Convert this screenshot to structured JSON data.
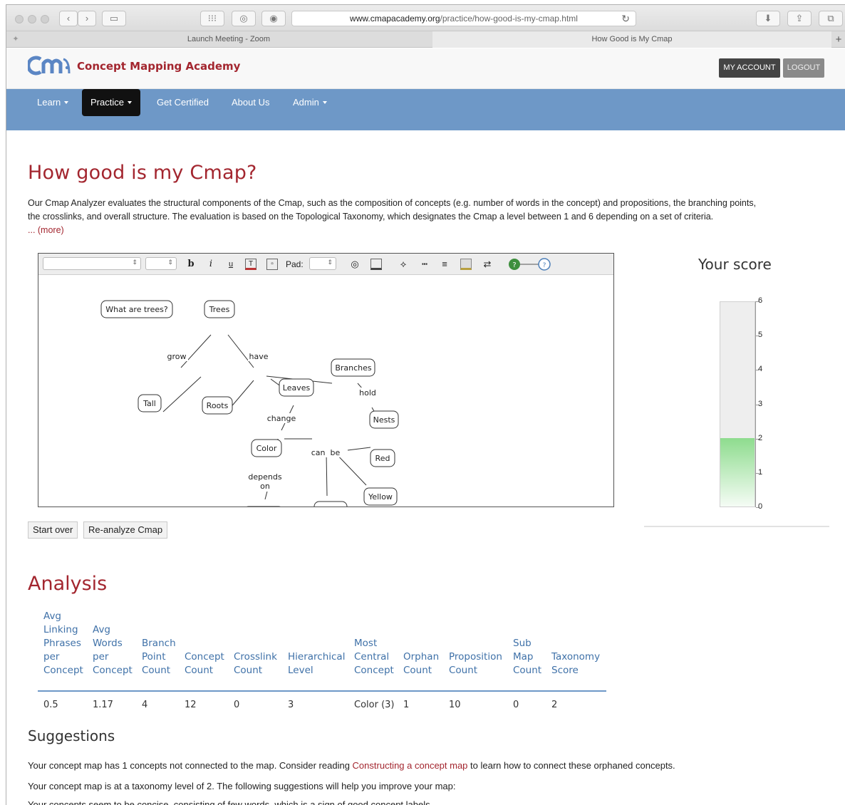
{
  "browser": {
    "url_host": "www.cmapacademy.org",
    "url_path": "/practice/how-good-is-my-cmap.html",
    "tabs": [
      "Launch Meeting - Zoom",
      "How Good is My Cmap"
    ]
  },
  "site": {
    "brand": "Concept Mapping Academy",
    "my_account": "MY ACCOUNT",
    "logout": "LOGOUT",
    "nav": [
      "Learn",
      "Practice",
      "Get Certified",
      "About Us",
      "Admin"
    ]
  },
  "page": {
    "title": "How good is my Cmap?",
    "intro_1": "Our Cmap Analyzer evaluates the structural components of the Cmap, such as the composition of concepts (e.g. number of words in the concept) and propositions, the branching points,",
    "intro_2": "the crosslinks, and overall structure. The evaluation is based on the Topological Taxonomy, which designates the Cmap a level between 1 and 6 depending on a set of criteria.",
    "more": "... (more)"
  },
  "toolbar": {
    "pad_label": "Pad:"
  },
  "cmap": {
    "concepts": [
      "What are trees?",
      "Trees",
      "Branches",
      "Leaves",
      "Tall",
      "Roots",
      "Nests",
      "Color",
      "Red",
      "Yellow"
    ],
    "links": [
      "grow",
      "have",
      "hold",
      "change",
      "can  be",
      "depends",
      "on"
    ]
  },
  "buttons": {
    "start_over": "Start over",
    "reanalyze": "Re-analyze Cmap"
  },
  "score": {
    "title": "Your score",
    "value": 2,
    "max": 6,
    "ticks": [
      "6",
      "5",
      "4",
      "3",
      "2",
      "1",
      "0"
    ]
  },
  "analysis": {
    "title": "Analysis",
    "headers": [
      [
        "Avg",
        "Linking",
        "Phrases",
        "per",
        "Concept"
      ],
      [
        "Avg",
        "Words",
        "per",
        "Concept"
      ],
      [
        "Branch",
        "Point",
        "Count"
      ],
      [
        "Concept",
        "Count"
      ],
      [
        "Crosslink",
        "Count"
      ],
      [
        "Hierarchical",
        "Level"
      ],
      [
        "Most",
        "Central",
        "Concept"
      ],
      [
        "Orphan",
        "Count"
      ],
      [
        "Proposition",
        "Count"
      ],
      [
        "Sub",
        "Map",
        "Count"
      ],
      [
        "Taxonomy",
        "Score"
      ]
    ],
    "values": [
      "0.5",
      "1.17",
      "4",
      "12",
      "0",
      "3",
      "Color (3)",
      "1",
      "10",
      "0",
      "2"
    ]
  },
  "suggestions": {
    "title": "Suggestions",
    "p1_a": "Your concept map has 1 concepts not connected to the map. Consider reading ",
    "p1_link": "Constructing a concept map",
    "p1_b": " to learn how to connect these orphaned concepts.",
    "p2": "Your concept map is at a taxonomy level of 2. The following suggestions will help you improve your map:",
    "p3": "Your concepts seem to be concise, consisting of few words, which is a sign of good concept labels."
  },
  "colors": {
    "brand_red": "#a3262f",
    "nav_blue": "#6e98c7",
    "header_blue": "#3f71a8",
    "score_green": "#8edc8e"
  }
}
